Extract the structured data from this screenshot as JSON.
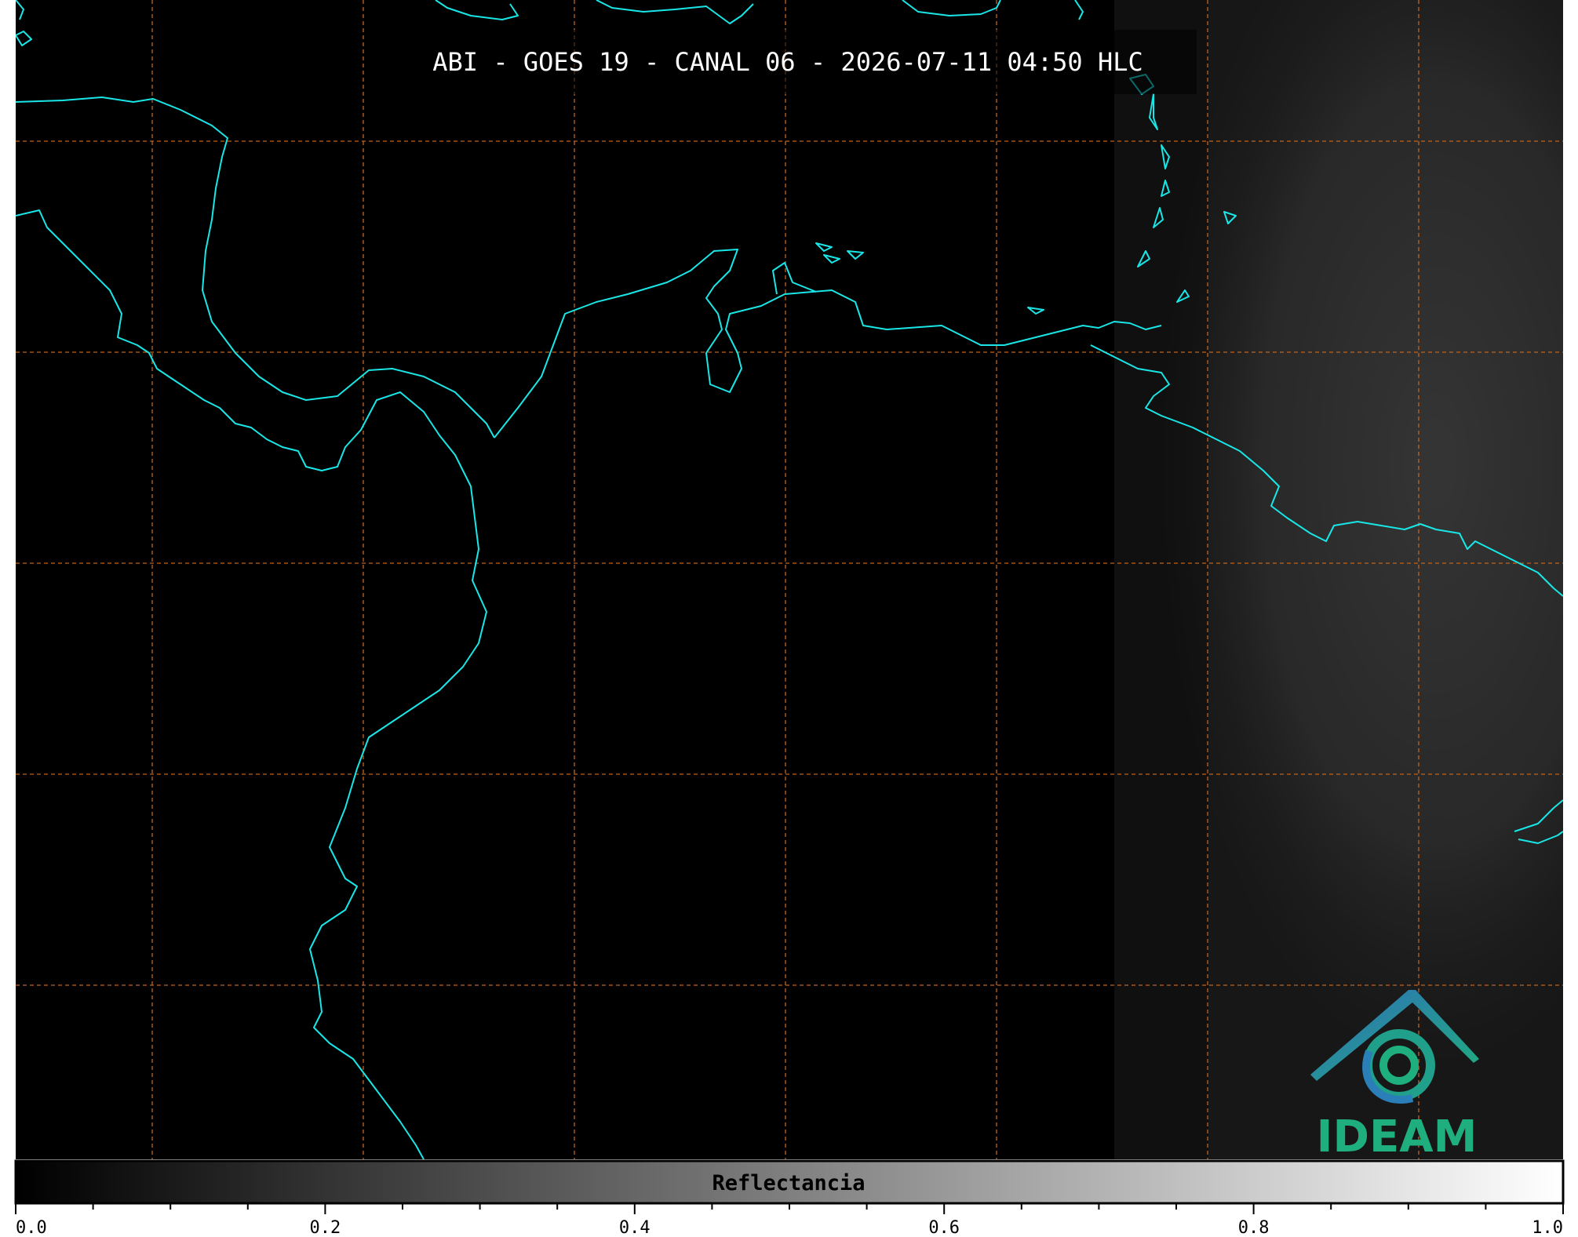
{
  "title": "ABI - GOES 19 - CANAL 06 - 2026-07-11 04:50 HLC",
  "colorbar": {
    "label": "Reflectancia",
    "range": [
      0.0,
      1.0
    ],
    "ticks": [
      "0.0",
      "0.2",
      "0.4",
      "0.6",
      "0.8",
      "1.0"
    ],
    "colormap": [
      "#000000",
      "#ffffff"
    ]
  },
  "logo": {
    "text": "IDEAM"
  },
  "colors": {
    "background": "#000000",
    "coastline": "#19e6e6",
    "grid": "#c0641e",
    "logo_blue": "#2a7fb8",
    "logo_green": "#1fae7e"
  },
  "icons": {
    "logo": "ideam-logo-icon"
  }
}
